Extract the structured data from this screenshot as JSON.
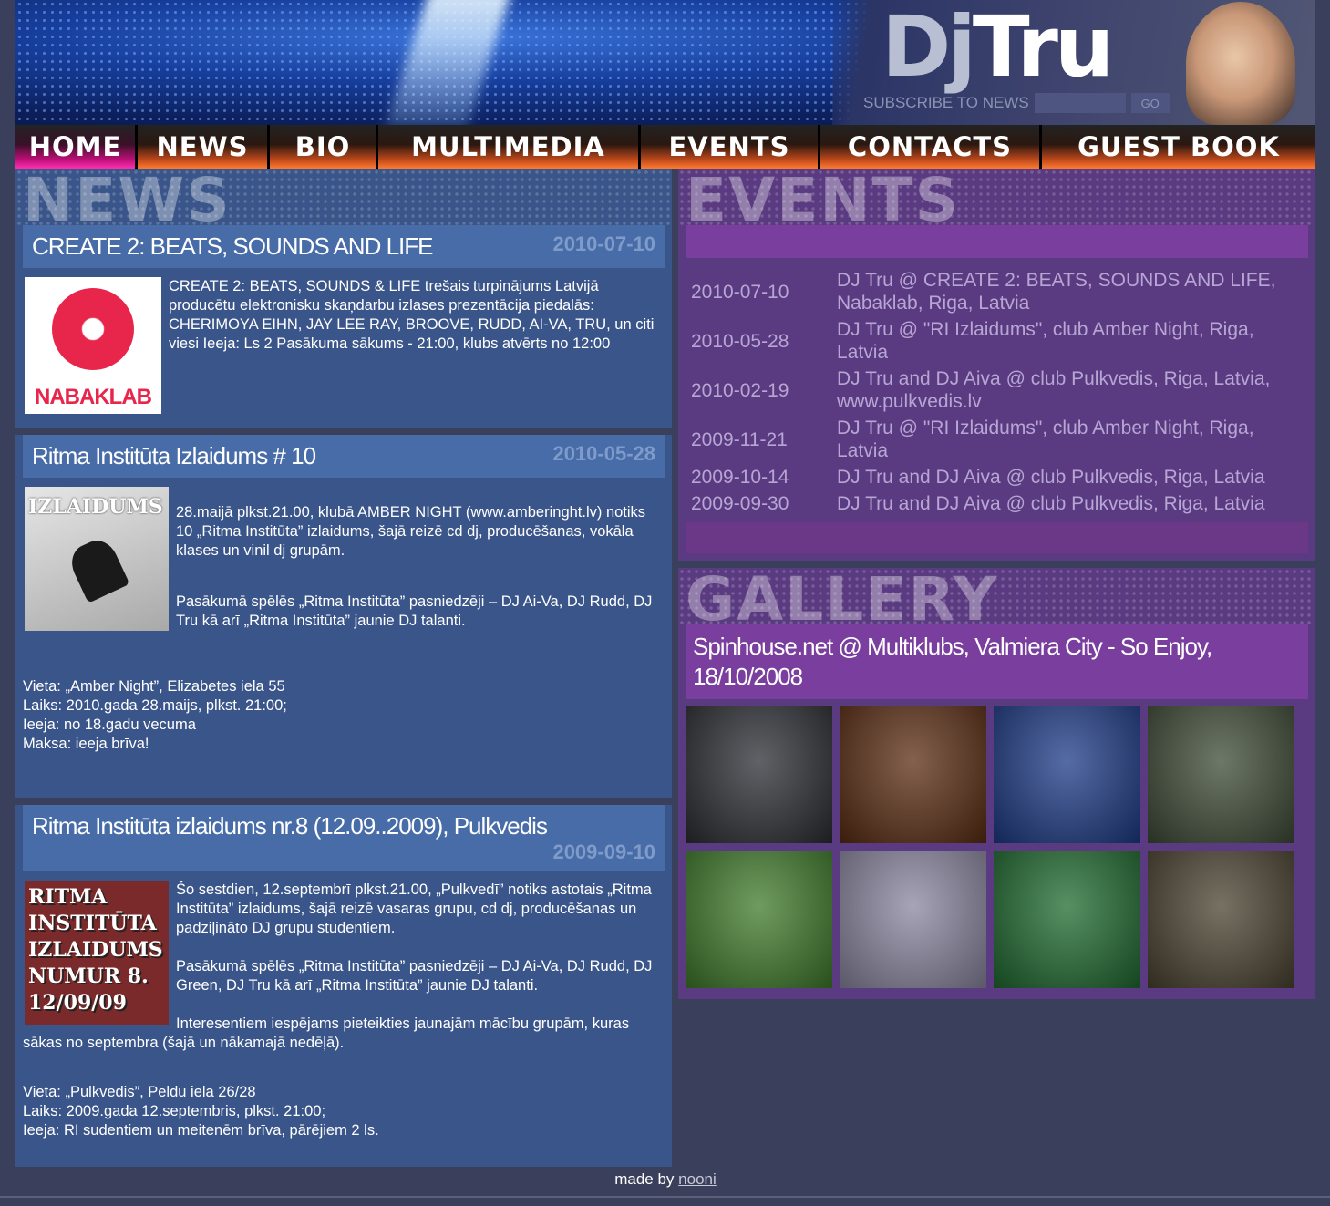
{
  "header": {
    "logo_dj": "Dj",
    "logo_tru": "Tru",
    "subscribe_label": "SUBSCRIBE TO NEWS",
    "subscribe_value": "",
    "go_label": "GO"
  },
  "nav": {
    "items": [
      {
        "label": "Home"
      },
      {
        "label": "News"
      },
      {
        "label": "Bio"
      },
      {
        "label": "Multimedia"
      },
      {
        "label": "Events"
      },
      {
        "label": "Contacts"
      },
      {
        "label": "Guest Book"
      }
    ]
  },
  "news": {
    "heading": "News",
    "items": [
      {
        "title": "CREATE 2: BEATS, SOUNDS AND LIFE",
        "date": "2010-07-10",
        "image_text": "NABAKLAB",
        "paragraphs": [
          "CREATE 2: BEATS, SOUNDS & LIFE trešais turpinājums Latvijā producētu elektronisku skaņdarbu izlases prezentācija piedalās: CHERIMOYA EIHN, JAY LEE RAY, BROOVE, RUDD, AI-VA, TRU, un citi viesi Ieeja: Ls 2 Pasākuma sākums - 21:00, klubs atvērts no 12:00"
        ]
      },
      {
        "title": "Ritma Institūta Izlaidums # 10",
        "date": "2010-05-28",
        "image_text": "IZLAIDUMS",
        "paragraphs": [
          "28.maijā plkst.21.00, klubā AMBER NIGHT (www.amberinght.lv) notiks 10 „Ritma Institūta” izlaidums, šajā reizē cd dj, producēšanas, vokāla klases un vinil dj grupām.",
          "Pasākumā spēlēs „Ritma Institūta” pasniedzēji – DJ Ai-Va, DJ Rudd, DJ Tru kā arī „Ritma Institūta” jaunie DJ talanti."
        ],
        "details": [
          "Vieta: „Amber Night”, Elizabetes iela 55",
          "Laiks: 2010.gada 28.maijs, plkst. 21:00;",
          "Ieeja: no 18.gadu vecuma",
          "Maksa: ieeja brīva!"
        ]
      },
      {
        "title": "Ritma Institūta izlaidums nr.8 (12.09..2009), Pulkvedis",
        "date": "2009-09-10",
        "image_text": "RITMA INSTITŪTA IZLAIDUMS NUMUR 8. 12/09/09",
        "paragraphs": [
          "Šo sestdien, 12.septembrī plkst.21.00, „Pulkvedī” notiks astotais „Ritma Institūta” izlaidums, šajā reizē vasaras grupu, cd dj, producēšanas un padziļināto DJ grupu studentiem.",
          "Pasākumā spēlēs „Ritma Institūta” pasniedzēji – DJ Ai-Va, DJ Rudd, DJ Green, DJ Tru kā arī „Ritma Institūta” jaunie DJ talanti.",
          "Interesentiem iespējams pieteikties jaunajām mācību grupām, kuras sākas no septembra (šajā un nākamajā nedēļā)."
        ],
        "details": [
          "Vieta: „Pulkvedis”, Peldu iela 26/28",
          "Laiks: 2009.gada 12.septembris, plkst. 21:00;",
          "Ieeja: RI sudentiem un meitenēm brīva, pārējiem 2 ls."
        ]
      }
    ]
  },
  "events": {
    "heading": "Events",
    "rows": [
      {
        "date": "2010-07-10",
        "text": "DJ Tru @ CREATE 2: BEATS, SOUNDS AND LIFE, Nabaklab, Riga, Latvia"
      },
      {
        "date": "2010-05-28",
        "text": "DJ Tru @ \"RI Izlaidums\", club Amber Night, Riga, Latvia"
      },
      {
        "date": "2010-02-19",
        "text": "DJ Tru and DJ Aiva @ club Pulkvedis, Riga, Latvia, www.pulkvedis.lv"
      },
      {
        "date": "2009-11-21",
        "text": "DJ Tru @ \"RI Izlaidums\", club Amber Night, Riga, Latvia"
      },
      {
        "date": "2009-10-14",
        "text": "DJ Tru and DJ Aiva @ club Pulkvedis, Riga, Latvia"
      },
      {
        "date": "2009-09-30",
        "text": "DJ Tru and DJ Aiva @ club Pulkvedis, Riga, Latvia"
      }
    ]
  },
  "gallery": {
    "heading": "Gallery",
    "title": "Spinhouse.net @ Multiklubs, Valmiera City - So Enjoy, 18/10/2008",
    "thumbs": [
      {
        "color": "#2a2d33"
      },
      {
        "color": "#5a2c12"
      },
      {
        "color": "#1d3a86"
      },
      {
        "color": "#3d4a35"
      },
      {
        "color": "#3f7a2a"
      },
      {
        "color": "#8a86a0"
      },
      {
        "color": "#1f6a2f"
      },
      {
        "color": "#4a4230"
      }
    ]
  },
  "footer": {
    "made_by": "made by",
    "link": "nooni"
  }
}
